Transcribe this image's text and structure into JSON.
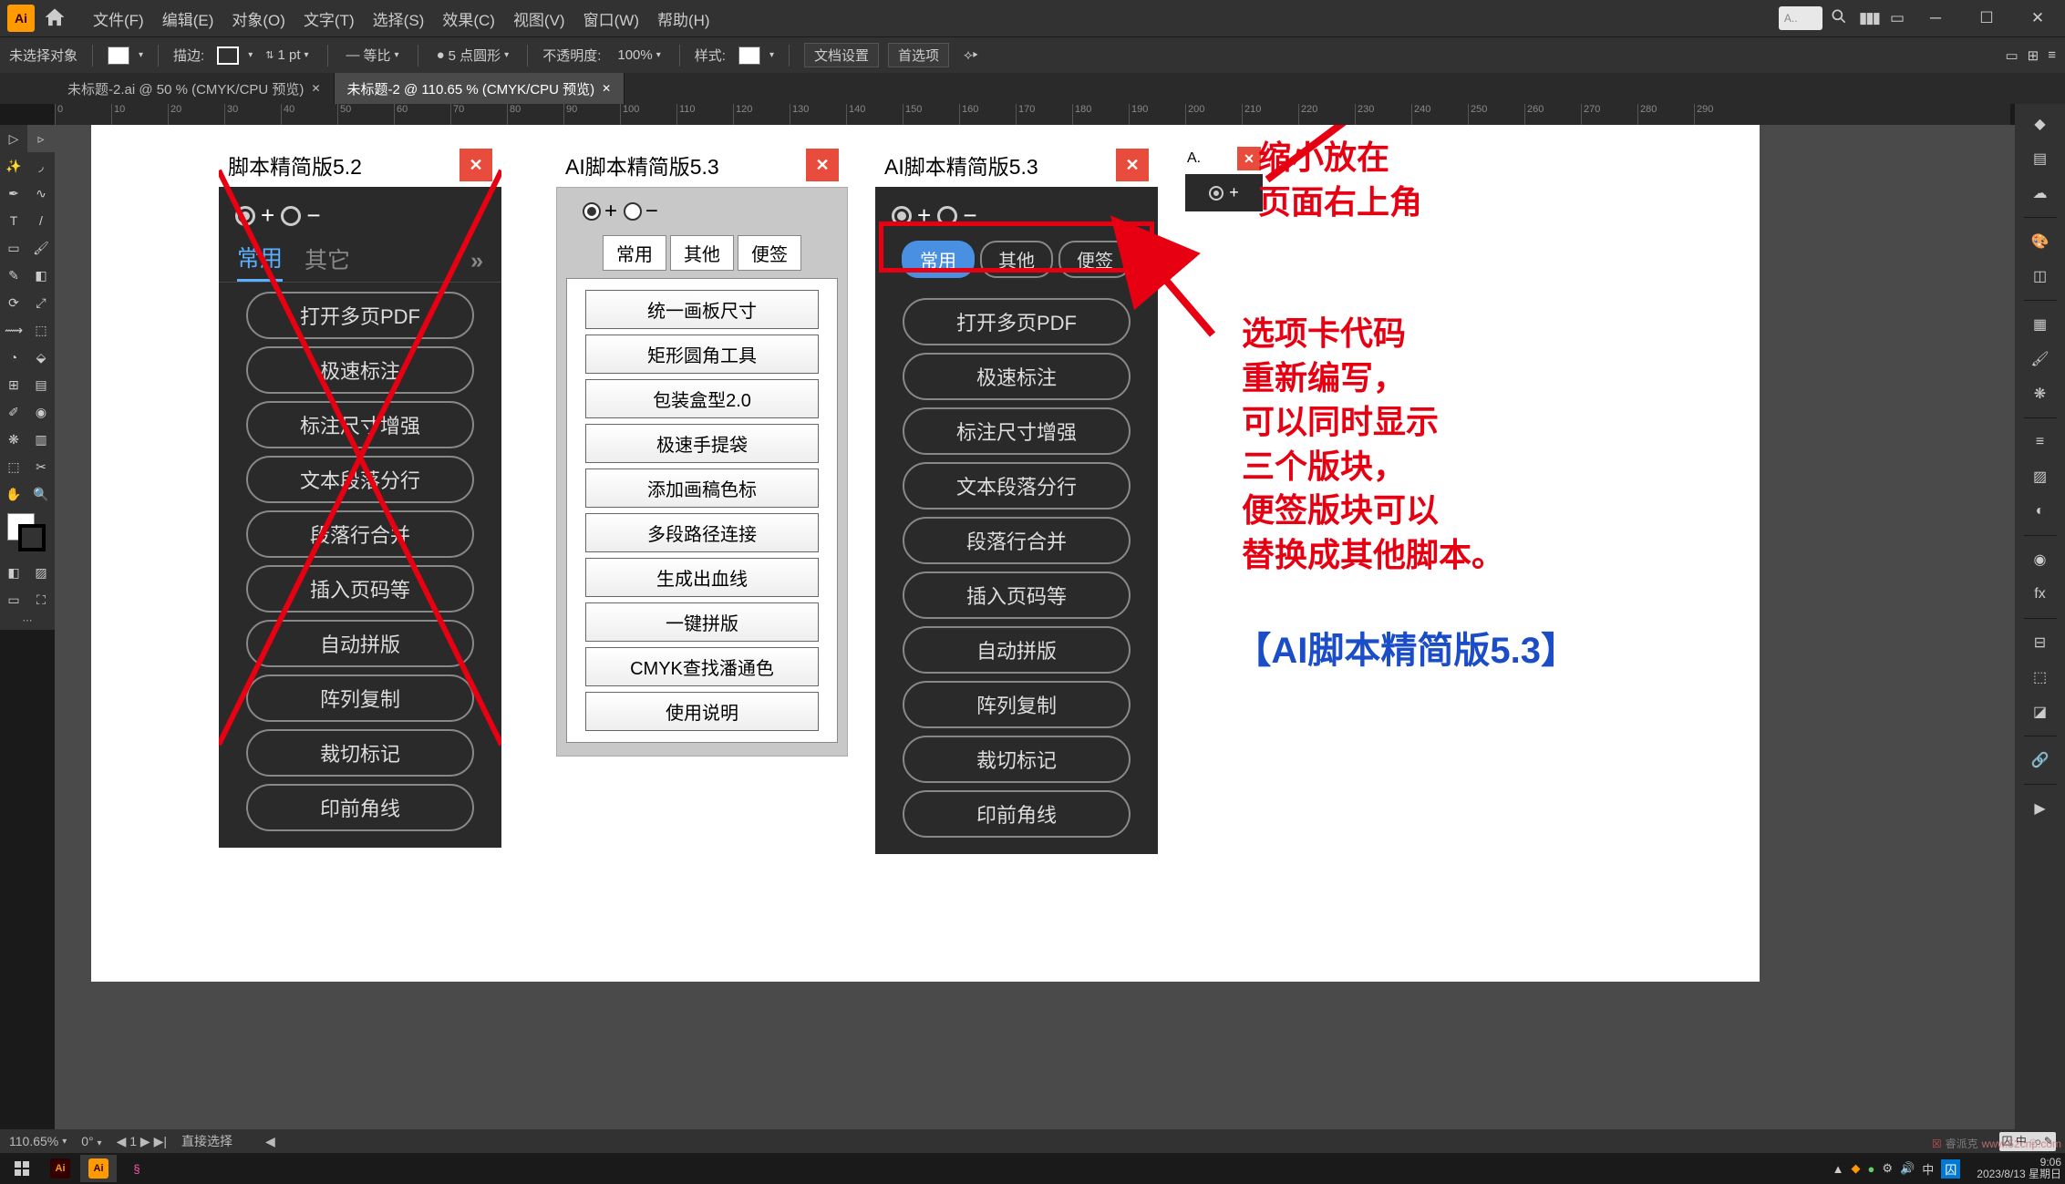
{
  "menu": {
    "items": [
      "文件(F)",
      "编辑(E)",
      "对象(O)",
      "文字(T)",
      "选择(S)",
      "效果(C)",
      "视图(V)",
      "窗口(W)",
      "帮助(H)"
    ]
  },
  "topsearch_placeholder": "A..",
  "opt": {
    "noselect": "未选择对象",
    "stroke_label": "描边:",
    "stroke_val": "1 pt",
    "uniform": "等比",
    "brush_val": "5 点圆形",
    "opacity_label": "不透明度:",
    "opacity_val": "100%",
    "style_label": "样式:",
    "docsetup": "文档设置",
    "prefs": "首选项"
  },
  "doctabs": [
    {
      "label": "未标题-2.ai @ 50 % (CMYK/CPU 预览)",
      "active": false
    },
    {
      "label": "未标题-2 @ 110.65 % (CMYK/CPU 预览)",
      "active": true
    }
  ],
  "ruler_marks": [
    0,
    10,
    20,
    30,
    40,
    50,
    60,
    70,
    80,
    90,
    100,
    110,
    120,
    130,
    140,
    150,
    160,
    170,
    180,
    190,
    200,
    210,
    220,
    230,
    240,
    250,
    260,
    270,
    280,
    290
  ],
  "status": {
    "zoom": "110.65%",
    "tool": "直接选择"
  },
  "panel52": {
    "title": "脚本精简版5.2",
    "tabs": [
      "常用",
      "其它"
    ],
    "buttons": [
      "打开多页PDF",
      "极速标注",
      "标注尺寸增强",
      "文本段落分行",
      "段落行合并",
      "插入页码等",
      "自动拼版",
      "阵列复制",
      "裁切标记",
      "印前角线"
    ]
  },
  "panel53l": {
    "title": "AI脚本精简版5.3",
    "tabs": [
      "常用",
      "其他",
      "便签"
    ],
    "buttons": [
      "统一画板尺寸",
      "矩形圆角工具",
      "包装盒型2.0",
      "极速手提袋",
      "添加画稿色标",
      "多段路径连接",
      "生成出血线",
      "一键拼版",
      "CMYK查找潘通色",
      "使用说明"
    ]
  },
  "panel53d": {
    "title": "AI脚本精简版5.3",
    "tabs": [
      "常用",
      "其他",
      "便签"
    ],
    "buttons": [
      "打开多页PDF",
      "极速标注",
      "标注尺寸增强",
      "文本段落分行",
      "段落行合并",
      "插入页码等",
      "自动拼版",
      "阵列复制",
      "裁切标记",
      "印前角线"
    ]
  },
  "panelmini": {
    "title": "A."
  },
  "anno1": "缩小放在\n页面右上角",
  "anno2": "选项卡代码\n重新编写，\n可以同时显示\n三个版块，\n便签版块可以\n替换成其他脚本。",
  "anno3": "【AI脚本精简版5.3】",
  "taskbar": {
    "time": "9:06",
    "date": "2023/8/13 星期日"
  },
  "watermark": "www.52cnp.com"
}
